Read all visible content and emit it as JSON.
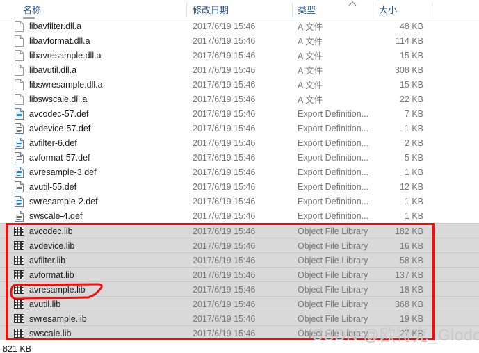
{
  "window": {
    "type": "file-explorer-list-view"
  },
  "header": {
    "columns": [
      {
        "label": "名称",
        "key": "name"
      },
      {
        "label": "修改日期",
        "key": "date"
      },
      {
        "label": "类型",
        "key": "type"
      },
      {
        "label": "大小",
        "key": "size"
      }
    ],
    "sort_indicator": "chevron-up"
  },
  "files": [
    {
      "name": "libavfilter.dll.a",
      "date": "2017/6/19 15:46",
      "type": "A 文件",
      "size": "48 KB",
      "icon": "blank-file-icon",
      "selected": false
    },
    {
      "name": "libavformat.dll.a",
      "date": "2017/6/19 15:46",
      "type": "A 文件",
      "size": "114 KB",
      "icon": "blank-file-icon",
      "selected": false
    },
    {
      "name": "libavresample.dll.a",
      "date": "2017/6/19 15:46",
      "type": "A 文件",
      "size": "15 KB",
      "icon": "blank-file-icon",
      "selected": false
    },
    {
      "name": "libavutil.dll.a",
      "date": "2017/6/19 15:46",
      "type": "A 文件",
      "size": "308 KB",
      "icon": "blank-file-icon",
      "selected": false
    },
    {
      "name": "libswresample.dll.a",
      "date": "2017/6/19 15:46",
      "type": "A 文件",
      "size": "15 KB",
      "icon": "blank-file-icon",
      "selected": false
    },
    {
      "name": "libswscale.dll.a",
      "date": "2017/6/19 15:46",
      "type": "A 文件",
      "size": "22 KB",
      "icon": "blank-file-icon",
      "selected": false
    },
    {
      "name": "avcodec-57.def",
      "date": "2017/6/19 15:46",
      "type": "Export Definition...",
      "size": "7 KB",
      "icon": "def-file-icon",
      "selected": false
    },
    {
      "name": "avdevice-57.def",
      "date": "2017/6/19 15:46",
      "type": "Export Definition...",
      "size": "1 KB",
      "icon": "def-file-icon",
      "selected": false
    },
    {
      "name": "avfilter-6.def",
      "date": "2017/6/19 15:46",
      "type": "Export Definition...",
      "size": "2 KB",
      "icon": "def-file-icon",
      "selected": false
    },
    {
      "name": "avformat-57.def",
      "date": "2017/6/19 15:46",
      "type": "Export Definition...",
      "size": "5 KB",
      "icon": "def-file-icon",
      "selected": false
    },
    {
      "name": "avresample-3.def",
      "date": "2017/6/19 15:46",
      "type": "Export Definition...",
      "size": "1 KB",
      "icon": "def-file-icon",
      "selected": false
    },
    {
      "name": "avutil-55.def",
      "date": "2017/6/19 15:46",
      "type": "Export Definition...",
      "size": "12 KB",
      "icon": "def-file-icon",
      "selected": false
    },
    {
      "name": "swresample-2.def",
      "date": "2017/6/19 15:46",
      "type": "Export Definition...",
      "size": "1 KB",
      "icon": "def-file-icon",
      "selected": false
    },
    {
      "name": "swscale-4.def",
      "date": "2017/6/19 15:46",
      "type": "Export Definition...",
      "size": "1 KB",
      "icon": "def-file-icon",
      "selected": false
    },
    {
      "name": "avcodec.lib",
      "date": "2017/6/19 15:46",
      "type": "Object File Library",
      "size": "182 KB",
      "icon": "lib-file-icon",
      "selected": true
    },
    {
      "name": "avdevice.lib",
      "date": "2017/6/19 15:46",
      "type": "Object File Library",
      "size": "16 KB",
      "icon": "lib-file-icon",
      "selected": true
    },
    {
      "name": "avfilter.lib",
      "date": "2017/6/19 15:46",
      "type": "Object File Library",
      "size": "58 KB",
      "icon": "lib-file-icon",
      "selected": true
    },
    {
      "name": "avformat.lib",
      "date": "2017/6/19 15:46",
      "type": "Object File Library",
      "size": "137 KB",
      "icon": "lib-file-icon",
      "selected": true
    },
    {
      "name": "avresample.lib",
      "date": "2017/6/19 15:46",
      "type": "Object File Library",
      "size": "18 KB",
      "icon": "lib-file-icon",
      "selected": true
    },
    {
      "name": "avutil.lib",
      "date": "2017/6/19 15:46",
      "type": "Object File Library",
      "size": "368 KB",
      "icon": "lib-file-icon",
      "selected": true
    },
    {
      "name": "swresample.lib",
      "date": "2017/6/19 15:46",
      "type": "Object File Library",
      "size": "19 KB",
      "icon": "lib-file-icon",
      "selected": true
    },
    {
      "name": "swscale.lib",
      "date": "2017/6/19 15:46",
      "type": "Object File Library",
      "size": "27 KB",
      "icon": "lib-file-icon",
      "selected": true
    }
  ],
  "annotations": {
    "rect_color": "#fb0b07",
    "oval_color": "#fb0b07",
    "highlighted_row": "avresample.lib"
  },
  "watermark": {
    "text": "CSDN @欧特克_Glodon",
    "color": "#c9c9c9"
  },
  "statusbar": {
    "text": "821 KB"
  }
}
